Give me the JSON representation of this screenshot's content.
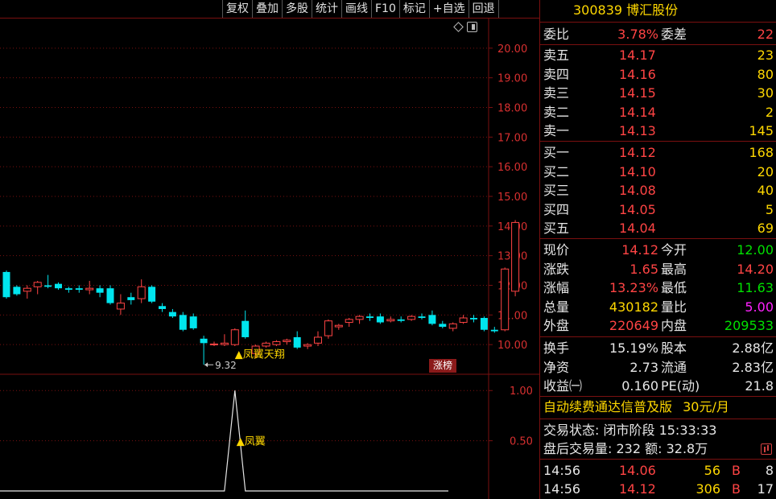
{
  "toolbar": {
    "buttons": [
      "复权",
      "叠加",
      "多股",
      "统计",
      "画线",
      "F10",
      "标记",
      "+自选",
      "回退"
    ]
  },
  "colors": {
    "up": "#ff4444",
    "down": "#00e5ee",
    "grid": "#7a1010",
    "label": "#ffd800"
  },
  "chart_data": [
    {
      "type": "candlestick",
      "y_ticks": [
        "20.00",
        "19.00",
        "18.00",
        "17.00",
        "16.00",
        "15.00",
        "14.00",
        "13.00",
        "12.00",
        "11.00",
        "10.00"
      ],
      "ylim": [
        9.0,
        21.0
      ],
      "candles": [
        {
          "o": 12.45,
          "h": 12.5,
          "l": 11.55,
          "c": 11.6
        },
        {
          "o": 11.95,
          "h": 12.0,
          "l": 11.65,
          "c": 11.7
        },
        {
          "o": 11.8,
          "h": 12.0,
          "l": 11.55,
          "c": 11.9
        },
        {
          "o": 11.95,
          "h": 12.15,
          "l": 11.7,
          "c": 12.1
        },
        {
          "o": 12.0,
          "h": 12.35,
          "l": 11.9,
          "c": 11.95
        },
        {
          "o": 12.05,
          "h": 12.1,
          "l": 11.85,
          "c": 11.9
        },
        {
          "o": 11.9,
          "h": 11.95,
          "l": 11.75,
          "c": 11.85
        },
        {
          "o": 11.9,
          "h": 12.0,
          "l": 11.75,
          "c": 11.85
        },
        {
          "o": 11.85,
          "h": 12.15,
          "l": 11.7,
          "c": 11.9
        },
        {
          "o": 11.9,
          "h": 12.0,
          "l": 11.6,
          "c": 11.75
        },
        {
          "o": 11.9,
          "h": 12.0,
          "l": 11.35,
          "c": 11.4
        },
        {
          "o": 11.2,
          "h": 11.7,
          "l": 11.0,
          "c": 11.4
        },
        {
          "o": 11.6,
          "h": 11.75,
          "l": 11.35,
          "c": 11.5
        },
        {
          "o": 11.55,
          "h": 12.2,
          "l": 11.4,
          "c": 11.95
        },
        {
          "o": 11.95,
          "h": 12.0,
          "l": 11.4,
          "c": 11.45
        },
        {
          "o": 11.3,
          "h": 11.4,
          "l": 11.1,
          "c": 11.2
        },
        {
          "o": 11.1,
          "h": 11.2,
          "l": 10.9,
          "c": 10.95
        },
        {
          "o": 11.0,
          "h": 11.1,
          "l": 10.45,
          "c": 10.5
        },
        {
          "o": 10.95,
          "h": 11.05,
          "l": 10.5,
          "c": 10.55
        },
        {
          "o": 10.2,
          "h": 10.3,
          "l": 9.32,
          "c": 10.05
        },
        {
          "o": 10.0,
          "h": 10.1,
          "l": 9.95,
          "c": 10.02
        },
        {
          "o": 10.0,
          "h": 10.35,
          "l": 9.95,
          "c": 10.05
        },
        {
          "o": 10.0,
          "h": 10.55,
          "l": 9.95,
          "c": 10.5
        },
        {
          "o": 10.8,
          "h": 11.15,
          "l": 10.2,
          "c": 10.25
        },
        {
          "o": 9.7,
          "h": 10.0,
          "l": 9.55,
          "c": 9.95
        },
        {
          "o": 9.95,
          "h": 10.1,
          "l": 9.9,
          "c": 10.05
        },
        {
          "o": 10.0,
          "h": 10.15,
          "l": 9.95,
          "c": 10.1
        },
        {
          "o": 10.1,
          "h": 10.2,
          "l": 10.0,
          "c": 10.15
        },
        {
          "o": 10.25,
          "h": 10.45,
          "l": 9.85,
          "c": 9.9
        },
        {
          "o": 9.95,
          "h": 10.05,
          "l": 9.85,
          "c": 10.0
        },
        {
          "o": 10.05,
          "h": 10.45,
          "l": 9.95,
          "c": 10.25
        },
        {
          "o": 10.3,
          "h": 10.85,
          "l": 10.2,
          "c": 10.8
        },
        {
          "o": 10.6,
          "h": 10.7,
          "l": 10.5,
          "c": 10.65
        },
        {
          "o": 10.75,
          "h": 10.9,
          "l": 10.6,
          "c": 10.85
        },
        {
          "o": 10.85,
          "h": 11.0,
          "l": 10.7,
          "c": 10.95
        },
        {
          "o": 10.95,
          "h": 11.05,
          "l": 10.8,
          "c": 10.9
        },
        {
          "o": 10.95,
          "h": 11.05,
          "l": 10.7,
          "c": 10.75
        },
        {
          "o": 10.8,
          "h": 10.95,
          "l": 10.75,
          "c": 10.85
        },
        {
          "o": 10.85,
          "h": 10.95,
          "l": 10.75,
          "c": 10.8
        },
        {
          "o": 10.85,
          "h": 11.0,
          "l": 10.8,
          "c": 10.95
        },
        {
          "o": 10.95,
          "h": 11.05,
          "l": 10.85,
          "c": 10.9
        },
        {
          "o": 11.0,
          "h": 11.15,
          "l": 10.65,
          "c": 10.7
        },
        {
          "o": 10.7,
          "h": 10.8,
          "l": 10.55,
          "c": 10.6
        },
        {
          "o": 10.55,
          "h": 10.75,
          "l": 10.45,
          "c": 10.7
        },
        {
          "o": 10.75,
          "h": 11.0,
          "l": 10.7,
          "c": 10.9
        },
        {
          "o": 10.9,
          "h": 11.0,
          "l": 10.75,
          "c": 10.85
        },
        {
          "o": 10.9,
          "h": 10.95,
          "l": 10.45,
          "c": 10.5
        },
        {
          "o": 10.5,
          "h": 10.6,
          "l": 10.4,
          "c": 10.45
        },
        {
          "o": 10.5,
          "h": 12.6,
          "l": 10.45,
          "c": 12.55
        },
        {
          "o": 11.8,
          "h": 14.2,
          "l": 11.63,
          "c": 14.12
        }
      ],
      "annotations": {
        "low_marker": "9.32",
        "signal_label": "▲凤翼天翔",
        "signal_index": 22
      }
    },
    {
      "type": "line",
      "y_ticks": [
        "1.00",
        "0.50"
      ],
      "ylim": [
        0,
        1.05
      ],
      "peak_index": 22,
      "peak_value": 1.0,
      "label": "▲凤翼"
    }
  ],
  "badges": {
    "zhangbang": "涨榜"
  },
  "quote": {
    "code": "300839",
    "name": "博汇股份",
    "weibi_label": "委比",
    "weibi_value": "3.78%",
    "weicha_label": "委差",
    "weicha_value": "22",
    "asks": [
      {
        "label": "卖五",
        "price": "14.17",
        "vol": "23"
      },
      {
        "label": "卖四",
        "price": "14.16",
        "vol": "80"
      },
      {
        "label": "卖三",
        "price": "14.15",
        "vol": "30"
      },
      {
        "label": "卖二",
        "price": "14.14",
        "vol": "2"
      },
      {
        "label": "卖一",
        "price": "14.13",
        "vol": "145"
      }
    ],
    "bids": [
      {
        "label": "买一",
        "price": "14.12",
        "vol": "168"
      },
      {
        "label": "买二",
        "price": "14.10",
        "vol": "20"
      },
      {
        "label": "买三",
        "price": "14.08",
        "vol": "40"
      },
      {
        "label": "买四",
        "price": "14.05",
        "vol": "5"
      },
      {
        "label": "买五",
        "price": "14.04",
        "vol": "69"
      }
    ],
    "stats": [
      {
        "l1": "现价",
        "v1": "14.12",
        "c1": "red",
        "l2": "今开",
        "v2": "12.00",
        "c2": "green"
      },
      {
        "l1": "涨跌",
        "v1": "1.65",
        "c1": "red",
        "l2": "最高",
        "v2": "14.20",
        "c2": "red"
      },
      {
        "l1": "涨幅",
        "v1": "13.23%",
        "c1": "red",
        "l2": "最低",
        "v2": "11.63",
        "c2": "green"
      },
      {
        "l1": "总量",
        "v1": "430182",
        "c1": "yellow",
        "l2": "量比",
        "v2": "5.00",
        "c2": "magenta"
      },
      {
        "l1": "外盘",
        "v1": "220649",
        "c1": "red",
        "l2": "内盘",
        "v2": "209533",
        "c2": "green"
      }
    ],
    "fundamentals": [
      {
        "l1": "换手",
        "v1": "15.19%",
        "l2": "股本",
        "v2": "2.88亿"
      },
      {
        "l1": "净资",
        "v1": "2.73",
        "l2": "流通",
        "v2": "2.83亿"
      },
      {
        "l1": "收益㈠",
        "v1": "0.160",
        "l2": "PE(动)",
        "v2": "21.8"
      }
    ],
    "ad_text": "自动续费通达信普及版",
    "ad_price": "30元/月",
    "trade_status": "交易状态: 闭市阶段 15:33:33",
    "after_hours": "盘后交易量: 232  额: 32.8万",
    "ticks": [
      {
        "time": "14:56",
        "price": "14.06",
        "vol": "56",
        "side": "B",
        "count": "8"
      },
      {
        "time": "14:56",
        "price": "14.12",
        "vol": "306",
        "side": "B",
        "count": "17"
      }
    ]
  }
}
